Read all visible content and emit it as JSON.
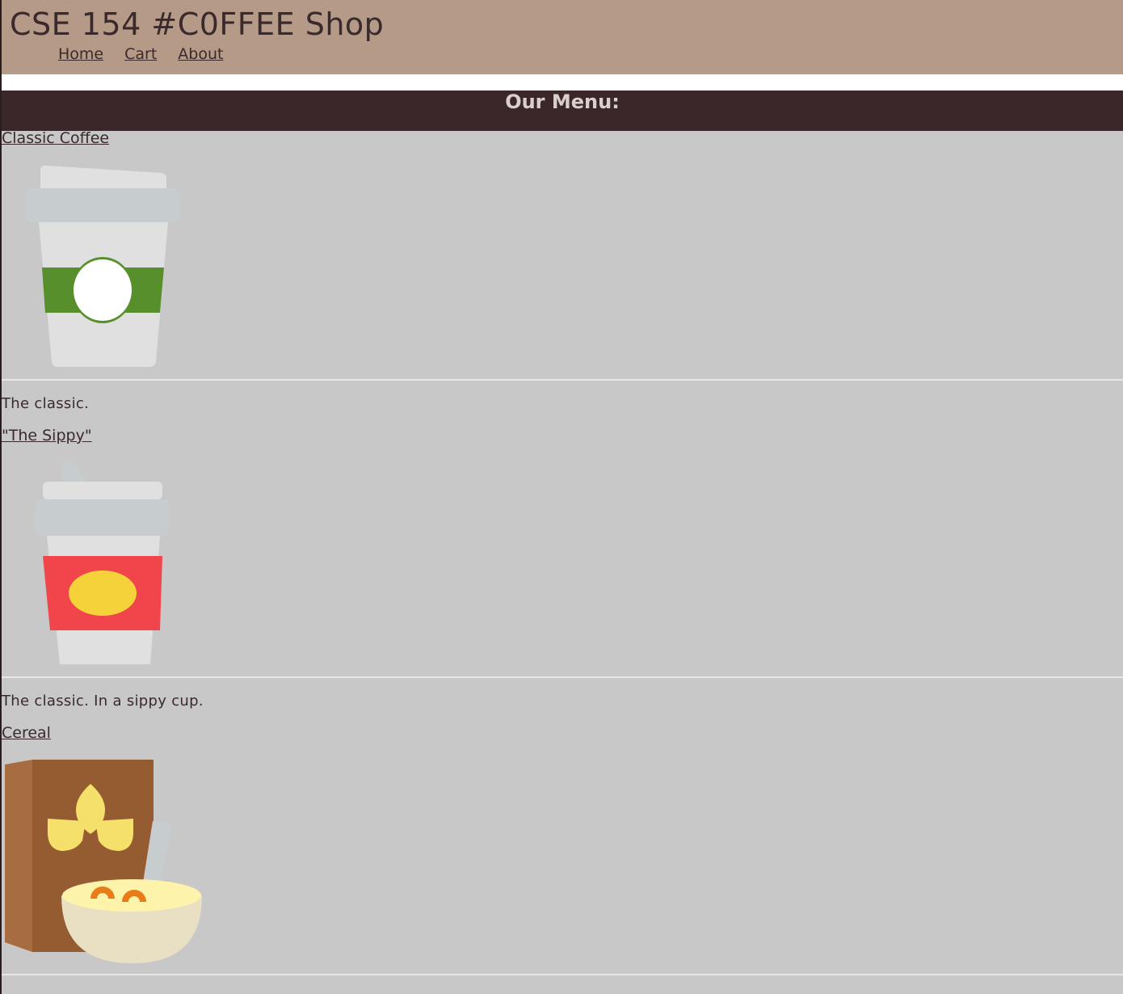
{
  "header": {
    "title": "CSE 154 #C0FFEE Shop",
    "nav": [
      "Home",
      "Cart",
      "About"
    ]
  },
  "menu": {
    "heading": "Our Menu:",
    "items": [
      {
        "name": "Classic Coffee",
        "description": "The classic.",
        "icon": "coffee-cup-green-sleeve-icon"
      },
      {
        "name": "\"The Sippy\"",
        "description": "The classic. In a sippy cup.",
        "icon": "sippy-cup-red-sleeve-icon"
      },
      {
        "name": "Cereal",
        "description": "",
        "icon": "cereal-box-and-bowl-icon"
      }
    ]
  },
  "colors": {
    "header_bg": "#b59a87",
    "heading_bg": "#3b2729",
    "content_bg": "#c8c8c8",
    "text": "#3a2a2c"
  }
}
